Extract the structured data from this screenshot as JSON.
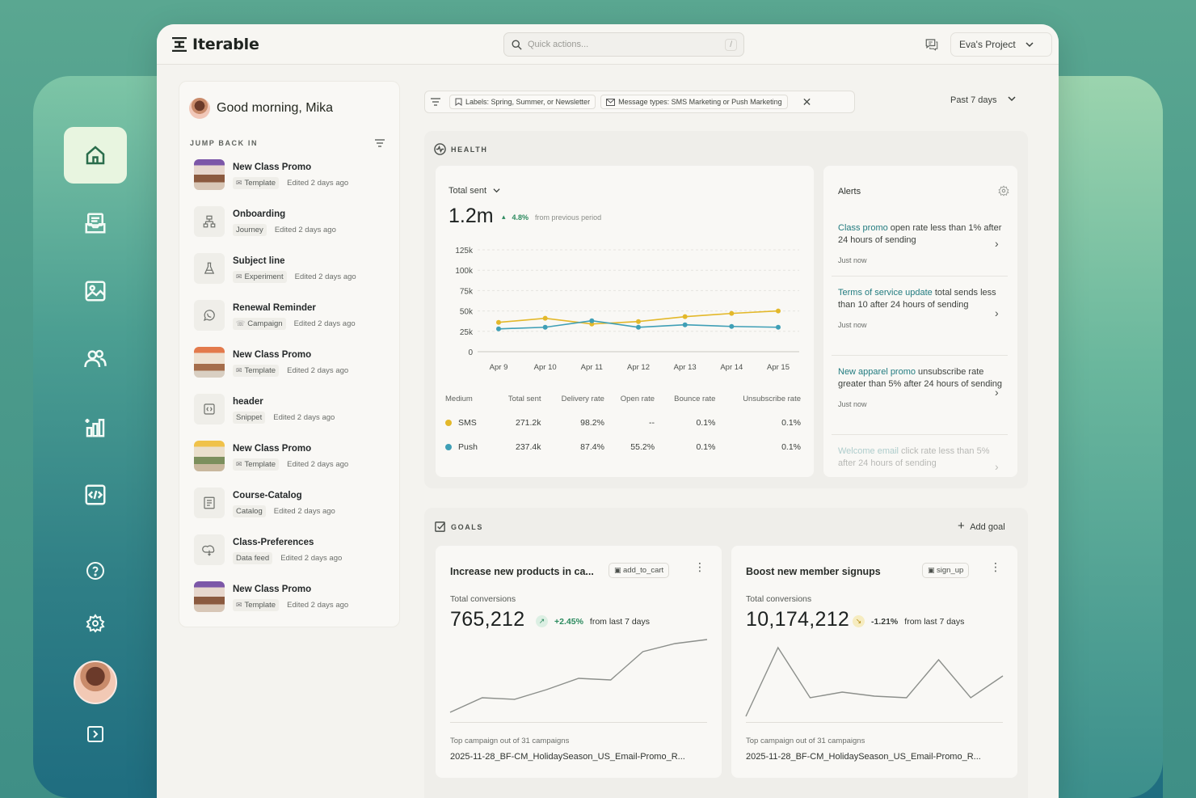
{
  "app": {
    "name": "Iterable"
  },
  "search": {
    "placeholder": "Quick actions...",
    "shortcut": "/"
  },
  "project": {
    "name": "Eva's Project"
  },
  "rail": {
    "items": [
      "home-icon",
      "inbox-icon",
      "image-icon",
      "users-icon",
      "analytics-icon",
      "code-icon",
      "help-icon",
      "gear-icon",
      "collapse-icon"
    ],
    "active_color": "#e8f5e0"
  },
  "left": {
    "greeting": "Good morning, Mika",
    "section": "JUMP BACK IN",
    "items": [
      {
        "title": "New Class Promo",
        "type": "Template",
        "edited": "Edited 2 days ago"
      },
      {
        "title": "Onboarding",
        "type": "Journey",
        "edited": "Edited 2 days ago"
      },
      {
        "title": "Subject line",
        "type": "Experiment",
        "edited": "Edited 2 days ago"
      },
      {
        "title": "Renewal Reminder",
        "type": "Campaign",
        "edited": "Edited 2 days ago"
      },
      {
        "title": "New Class Promo",
        "type": "Template",
        "edited": "Edited 2 days ago"
      },
      {
        "title": "header",
        "type": "Snippet",
        "edited": "Edited 2 days ago"
      },
      {
        "title": "New Class Promo",
        "type": "Template",
        "edited": "Edited 2 days ago"
      },
      {
        "title": "Course-Catalog",
        "type": "Catalog",
        "edited": "Edited 2 days ago"
      },
      {
        "title": "Class-Preferences",
        "type": "Data feed",
        "edited": "Edited 2 days ago"
      },
      {
        "title": "New Class Promo",
        "type": "Template",
        "edited": "Edited 2 days ago"
      }
    ]
  },
  "filters": {
    "labels_chip": "Labels: Spring, Summer, or Newsletter",
    "types_chip": "Message types: SMS Marketing or Push Marketing",
    "clear": "✕",
    "period": "Past 7 days"
  },
  "health": {
    "section": "HEALTH",
    "metric_label": "Total sent",
    "total": "1.2m",
    "delta": "4.8%",
    "delta_note": "from previous period",
    "table": {
      "headers": [
        "Medium",
        "Total sent",
        "Delivery rate",
        "Open rate",
        "Bounce rate",
        "Unsubscribe rate"
      ],
      "rows": [
        [
          "SMS",
          "271.2k",
          "98.2%",
          "--",
          "0.1%",
          "0.1%"
        ],
        [
          "Push",
          "237.4k",
          "87.4%",
          "55.2%",
          "0.1%",
          "0.1%"
        ]
      ]
    },
    "colors": {
      "sms": "#e3b82a",
      "push": "#3f9fb6"
    }
  },
  "chart_data": {
    "type": "line",
    "x": [
      "Apr 9",
      "Apr 10",
      "Apr 11",
      "Apr 12",
      "Apr 13",
      "Apr 14",
      "Apr 15"
    ],
    "yticks": [
      "125k",
      "100k",
      "75k",
      "50k",
      "25k",
      "0"
    ],
    "ylim": [
      0,
      125000
    ],
    "series": [
      {
        "name": "SMS",
        "color": "#e3b82a",
        "values": [
          36000,
          41000,
          34000,
          37000,
          43000,
          47000,
          50000
        ]
      },
      {
        "name": "Push",
        "color": "#3f9fb6",
        "values": [
          28000,
          30000,
          38000,
          30000,
          33000,
          31000,
          30000
        ]
      }
    ],
    "grid": true
  },
  "alerts": {
    "title": "Alerts",
    "items": [
      {
        "highlight": "Class promo",
        "text": " open rate less than 1% after 24 hours of sending",
        "when": "Just now"
      },
      {
        "highlight": "Terms of service update",
        "text": " total sends less than 10 after 24 hours of sending",
        "when": "Just now"
      },
      {
        "highlight": "New apparel promo",
        "text": " unsubscribe rate greater than 5% after 24 hours of sending",
        "when": "Just now"
      },
      {
        "highlight": "Welcome email",
        "text": " click rate less than 5% after 24 hours of sending",
        "when": ""
      }
    ]
  },
  "goals": {
    "section": "GOALS",
    "add_label": "Add goal",
    "cards": [
      {
        "title": "Increase new products in ca...",
        "tag": "add_to_cart",
        "sub": "Total conversions",
        "value": "765,212",
        "delta": "+2.45%",
        "delta_note": "from last 7 days",
        "foot_label": "Top campaign out of 31 campaigns",
        "foot_value": "2025-11-28_BF-CM_HolidaySeason_US_Email-Promo_R...",
        "trend": [
          10,
          28,
          26,
          38,
          52,
          50,
          85,
          95,
          100
        ]
      },
      {
        "title": "Boost new member signups",
        "tag": "sign_up",
        "sub": "Total conversions",
        "value": "10,174,212",
        "delta": "-1.21%",
        "delta_note": "from last 7 days",
        "foot_label": "Top campaign out of 31 campaigns",
        "foot_value": "2025-11-28_BF-CM_HolidaySeason_US_Email-Promo_R...",
        "trend": [
          5,
          90,
          28,
          35,
          30,
          28,
          75,
          28,
          55
        ]
      }
    ]
  }
}
